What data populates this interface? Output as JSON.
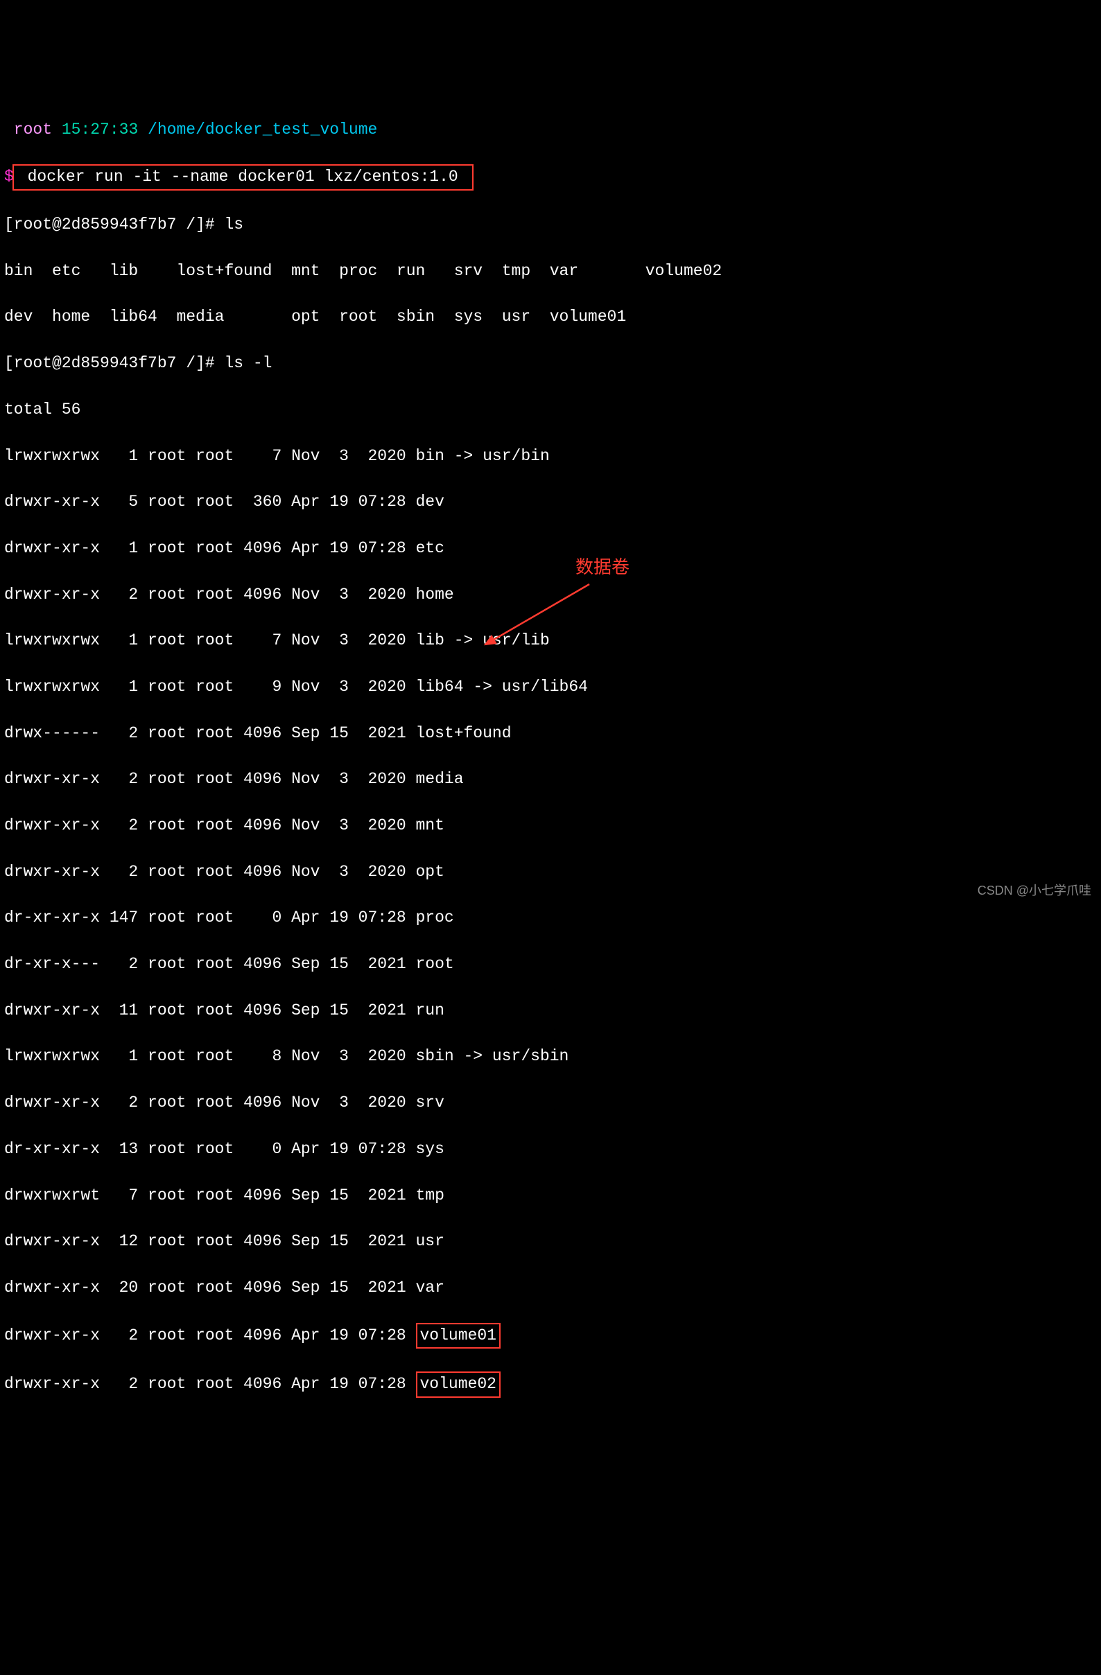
{
  "prompt": {
    "user": " root ",
    "time": "15:27:33 ",
    "path": "/home/docker_test_volume"
  },
  "dollar": "$",
  "docker_cmd": " docker run -it --name docker01 lxz/centos:1.0 ",
  "inner_prompt1": "[root@2d859943f7b7 /]# ls",
  "ls_output": {
    "row1": "bin  etc   lib    lost+found  mnt  proc  run   srv  tmp  var       volume02",
    "row2": "dev  home  lib64  media       opt  root  sbin  sys  usr  volume01"
  },
  "inner_prompt2": "[root@2d859943f7b7 /]# ls -l",
  "total": "total 56",
  "listing": [
    "lrwxrwxrwx   1 root root    7 Nov  3  2020 bin -> usr/bin",
    "drwxr-xr-x   5 root root  360 Apr 19 07:28 dev",
    "drwxr-xr-x   1 root root 4096 Apr 19 07:28 etc",
    "drwxr-xr-x   2 root root 4096 Nov  3  2020 home",
    "lrwxrwxrwx   1 root root    7 Nov  3  2020 lib -> usr/lib",
    "lrwxrwxrwx   1 root root    9 Nov  3  2020 lib64 -> usr/lib64",
    "drwx------   2 root root 4096 Sep 15  2021 lost+found",
    "drwxr-xr-x   2 root root 4096 Nov  3  2020 media",
    "drwxr-xr-x   2 root root 4096 Nov  3  2020 mnt",
    "drwxr-xr-x   2 root root 4096 Nov  3  2020 opt",
    "dr-xr-xr-x 147 root root    0 Apr 19 07:28 proc",
    "dr-xr-x---   2 root root 4096 Sep 15  2021 root",
    "drwxr-xr-x  11 root root 4096 Sep 15  2021 run",
    "lrwxrwxrwx   1 root root    8 Nov  3  2020 sbin -> usr/sbin",
    "drwxr-xr-x   2 root root 4096 Nov  3  2020 srv",
    "dr-xr-xr-x  13 root root    0 Apr 19 07:28 sys",
    "drwxrwxrwt   7 root root 4096 Sep 15  2021 tmp",
    "drwxr-xr-x  12 root root 4096 Sep 15  2021 usr",
    "drwxr-xr-x  20 root root 4096 Sep 15  2021 var"
  ],
  "volume_rows": [
    {
      "prefix": "drwxr-xr-x   2 root root 4096 Apr 19 07:28 ",
      "name": "volume01"
    },
    {
      "prefix": "drwxr-xr-x   2 root root 4096 Apr 19 07:28 ",
      "name": "volume02"
    }
  ],
  "annotation_label": "数据卷",
  "watermark": "CSDN @小七学爪哇"
}
